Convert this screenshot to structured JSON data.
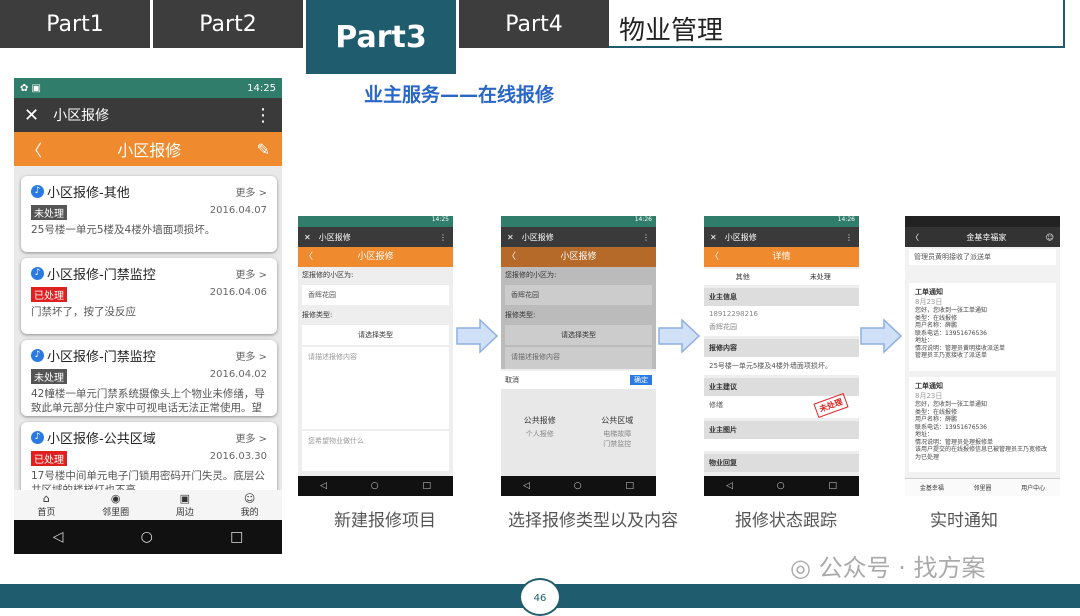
{
  "tabs": [
    {
      "label": "Part1"
    },
    {
      "label": "Part2"
    },
    {
      "label": "Part3"
    },
    {
      "label": "Part4"
    }
  ],
  "heading": "物业管理",
  "subtitle": "业主服务——在线报修",
  "big_phone": {
    "status_time": "14:25",
    "app_title": "小区报修",
    "orange_title": "小区报修",
    "cards": [
      {
        "title": "小区报修-其他",
        "more": "更多 >",
        "status": "未处理",
        "date": "2016.04.07",
        "desc": "25号楼一单元5楼及4楼外墙面项损坏。"
      },
      {
        "title": "小区报修-门禁监控",
        "more": "更多 >",
        "status": "已处理",
        "date": "2016.04.06",
        "desc": "门禁坏了，按了没反应"
      },
      {
        "title": "小区报修-门禁监控",
        "more": "更多 >",
        "status": "未处理",
        "date": "2016.04.02",
        "desc": "42幢楼一单元门禁系统摄像头上个物业未修缮，导致此单元部分住户家中可视电话无法正常使用。望"
      },
      {
        "title": "小区报修-公共区域",
        "more": "更多 >",
        "status": "已处理",
        "date": "2016.03.30",
        "desc": "17号楼中间单元电子门锁用密码开门失灵。底层公共区域的楼梯灯也不亮"
      }
    ],
    "nav": [
      {
        "label": "首页"
      },
      {
        "label": "邻里圈"
      },
      {
        "label": "周边"
      },
      {
        "label": "我的"
      }
    ]
  },
  "phone2": {
    "time": "14:25",
    "app_title": "小区报修",
    "orange_title": "小区报修",
    "l1": "您报修的小区为:",
    "v1": "香辉花园",
    "l2": "报修类型:",
    "type_btn": "请选择类型",
    "ph": "请描述报修内容",
    "ph2": "您希望物业做什么"
  },
  "phone3": {
    "time": "14:26",
    "app_title": "小区报修",
    "orange_title": "小区报修",
    "l1": "您报修的小区为:",
    "v1": "香辉花园",
    "l2": "报修类型:",
    "type_btn": "请选择类型",
    "ph": "请描述报修内容",
    "cancel": "取消",
    "ok": "确定",
    "col1": "公共报修",
    "col2": "公共区域",
    "opt1": "个人报修",
    "opt2": "电梯故障",
    "opt3": "门禁监控"
  },
  "phone4": {
    "time": "14:26",
    "app_title": "小区报修",
    "orange_title": "详情",
    "seg1": "其他",
    "seg2": "未处理",
    "s1": "业主信息",
    "phone": "18912298216",
    "addr": "香辉花园",
    "s2": "报修内容",
    "content": "25号楼一单元5楼及4楼外墙面项损坏。",
    "s3": "业主建议",
    "sugg": "修缮",
    "stamp": "未处理",
    "s4": "业主图片",
    "s5": "物业回复"
  },
  "phone5": {
    "title": "金基幸福家",
    "n1": "管理员黄明接收了派送单",
    "card1": {
      "h": "工单通知",
      "d": "8月23日",
      "t": "您好，您收到一张工单通知\n类型：在线报修\n用户名称：薛鹏\n联系电话：13951676536\n地址：\n情况说明：管理员黄明接收派送单\n管理员王乃宽接收了派送单"
    },
    "card2": {
      "h": "工单通知",
      "d": "8月23日",
      "t": "您好，您收到一张工单通知\n类型：在线报修\n用户名称：薛鹏\n联系电话：13951676536\n地址：\n情况说明：管理员处理报修单\n该用户提交的在线报修信息已被管理员王乃宽修改为已处理"
    },
    "tabs": [
      "金基幸福",
      "邻里圈",
      "用户中心"
    ]
  },
  "captions": [
    "新建报修项目",
    "选择报修类型以及内容",
    "报修状态跟踪",
    "实时通知"
  ],
  "page_number": "46",
  "watermark": "公众号 · 找方案"
}
